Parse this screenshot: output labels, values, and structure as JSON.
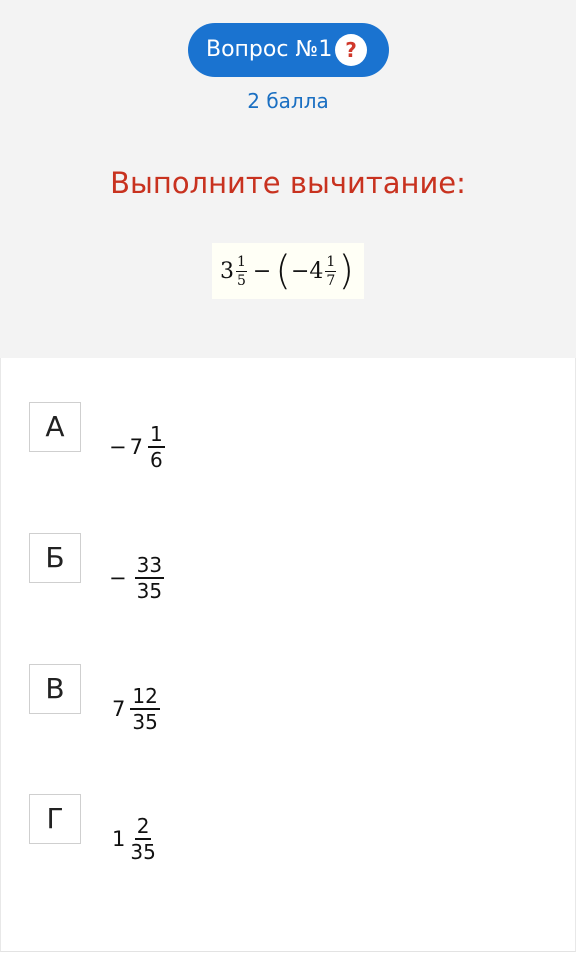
{
  "question": {
    "label": "Вопрос №1",
    "help_icon": "?",
    "points": "2 балла",
    "task": "Выполните вычитание:",
    "expression": {
      "whole1": "3",
      "num1": "1",
      "den1": "5",
      "minus": "−",
      "open_paren": "(",
      "inner": "−4",
      "num2": "1",
      "den2": "7",
      "close_paren": ")"
    }
  },
  "options": [
    {
      "letter": "А",
      "sign": "−",
      "whole": "7",
      "num": "1",
      "den": "6"
    },
    {
      "letter": "Б",
      "sign": "−",
      "whole": "",
      "num": "33",
      "den": "35"
    },
    {
      "letter": "В",
      "sign": "",
      "whole": "7",
      "num": "12",
      "den": "35"
    },
    {
      "letter": "Г",
      "sign": "",
      "whole": "1",
      "num": "2",
      "den": "35"
    }
  ],
  "colors": {
    "pill": "#1a73d0",
    "points": "#1a6fc2",
    "task": "#c8321f",
    "help": "#d0382b"
  }
}
